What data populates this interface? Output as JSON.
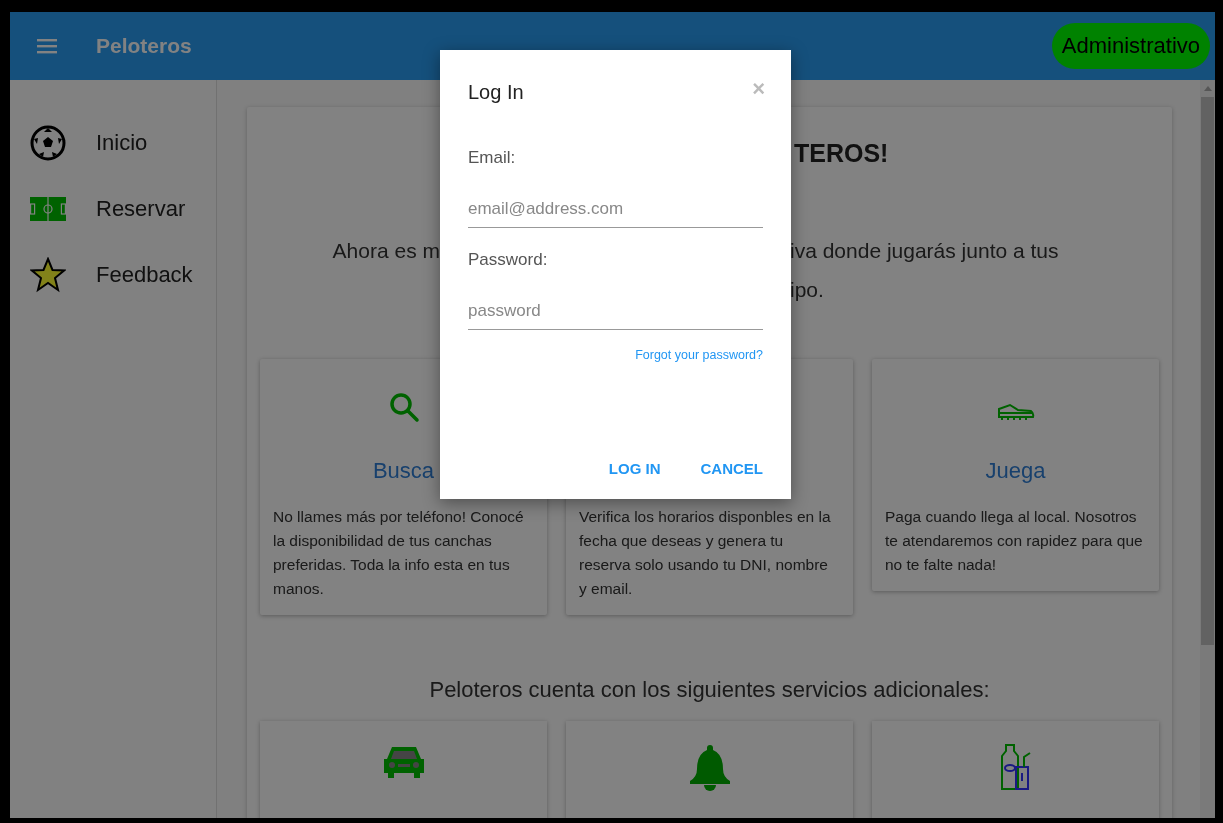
{
  "header": {
    "title": "Peloteros",
    "badge": "Administrativo"
  },
  "sidebar": {
    "items": [
      {
        "kind": "ball",
        "label": "Inicio"
      },
      {
        "kind": "field",
        "label": "Reservar"
      },
      {
        "kind": "star",
        "label": "Feedback"
      }
    ]
  },
  "welcome": {
    "heading_visible": "TEROS!",
    "intro_left": "Ahora es m",
    "intro_right": [
      "iva donde jugarás junto a tus",
      "ipo."
    ]
  },
  "features": [
    {
      "kind": "search",
      "title": "Busca",
      "text": "No llames más por teléfono! Conocé la disponibilidad de tus canchas preferidas. Toda la info esta en tus manos."
    },
    {
      "kind": "hidden",
      "text": "Verifica los horarios disponbles en la fecha que deseas y genera tu reserva solo usando tu DNI, nombre y email."
    },
    {
      "kind": "shoe",
      "title": "Juega",
      "text": "Paga cuando llega al local. Nosotros te atendaremos con rapidez para que no te falte nada!"
    }
  ],
  "services": {
    "heading": "Peloteros cuenta con los siguientes servicios adicionales:",
    "items": [
      {
        "kind": "car"
      },
      {
        "kind": "bell"
      },
      {
        "kind": "drinks"
      }
    ]
  },
  "dialog": {
    "title": "Log In",
    "close": "×",
    "fields": [
      {
        "label": "Email:",
        "placeholder": "email@address.com"
      },
      {
        "label": "Password:",
        "placeholder": "password"
      }
    ],
    "forgot_link": "Forgot your password?",
    "buttons": [
      "LOG IN",
      "CANCEL"
    ]
  }
}
